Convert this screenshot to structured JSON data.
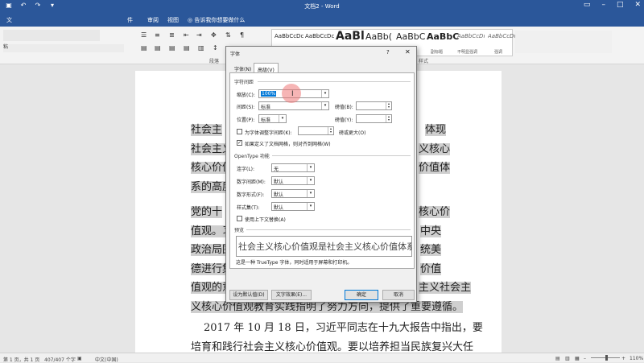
{
  "app": {
    "window_title": "文档2 - Word",
    "tabs": [
      "件",
      "审阅",
      "视图"
    ],
    "tell_me": "告诉我你想要做什么"
  },
  "ribbon": {
    "paste_label": "粘",
    "paragraph_group": "段落",
    "styles_group": "样式",
    "styles": [
      {
        "sample": "AaBbCcDc",
        "name": ""
      },
      {
        "sample": "AaBbCcDc",
        "name": ""
      },
      {
        "sample": "AaBl",
        "name": ""
      },
      {
        "sample": "AaBb(",
        "name": ""
      },
      {
        "sample": "AaBbC",
        "name": ""
      },
      {
        "sample": "AaBbC",
        "name": "副标题"
      },
      {
        "sample": "AaBbCcDı",
        "name": "不明显强调"
      },
      {
        "sample": "AaBbCcDı",
        "name": "强调"
      }
    ]
  },
  "document": {
    "lines": [
      {
        "text": "社会主",
        "right": "体现"
      },
      {
        "text": "社会主义",
        "right": "义核心"
      },
      {
        "text": "核心价值",
        "right": "价值体"
      },
      {
        "text": "系的高度",
        "right": ""
      },
      {
        "text": "党的十",
        "right": "核心价"
      },
      {
        "text": "值观。习",
        "right": "中央"
      },
      {
        "text": "政治局围",
        "right": "统美"
      },
      {
        "text": "德进行集",
        "right": "价值"
      },
      {
        "text": "值观的意",
        "right": "主义社会主"
      },
      {
        "text": "义核心价值观教育实践指明了努力方向，提供了重要遵循。",
        "right": ""
      },
      {
        "text": "2017 年 10 月 18 日，习近平同志在十九大报告中指出，要",
        "right": ""
      },
      {
        "text": "培育和践行社会主义核心价值观。要以培养担当民族复兴大任",
        "right": ""
      }
    ]
  },
  "dialog": {
    "title": "字体",
    "help": "?",
    "close": "✕",
    "tabs": [
      "字体(N)",
      "高级(V)"
    ],
    "char_spacing": {
      "section": "字符间距",
      "scale_label": "缩放(C):",
      "scale_value": "100%",
      "spacing_label": "间距(S):",
      "spacing_value": "标准",
      "spacing_by_label": "磅值(B):",
      "position_label": "位置(P):",
      "position_value": "标准",
      "position_by_label": "磅值(Y):",
      "kerning_label": "为字体调整字间距(K):",
      "kerning_suffix": "磅或更大(O)",
      "grid_label": "如果定义了文档网格，则对齐到网格(W)"
    },
    "opentype": {
      "section": "OpenType 功能",
      "ligatures_label": "连字(L):",
      "ligatures_value": "无",
      "numspacing_label": "数字间距(M):",
      "numspacing_value": "默认",
      "numforms_label": "数字形式(F):",
      "numforms_value": "默认",
      "stylesets_label": "样式集(T):",
      "stylesets_value": "默认",
      "contextual_label": "使用上下文替换(A)"
    },
    "preview": {
      "section": "预览",
      "text": "社会主义核心价值观是社会主义核心价值体系的",
      "note": "这是一种 TrueType 字体，同时适用于屏幕和打印机。"
    },
    "buttons": {
      "default": "设为默认值(D)",
      "effects": "文字效果(E)...",
      "ok": "确定",
      "cancel": "取消"
    }
  },
  "status": {
    "page": "第 1 页，共 1 页",
    "words": "407/407 个字",
    "lang": "中文(中国)",
    "zoom": "110%"
  }
}
